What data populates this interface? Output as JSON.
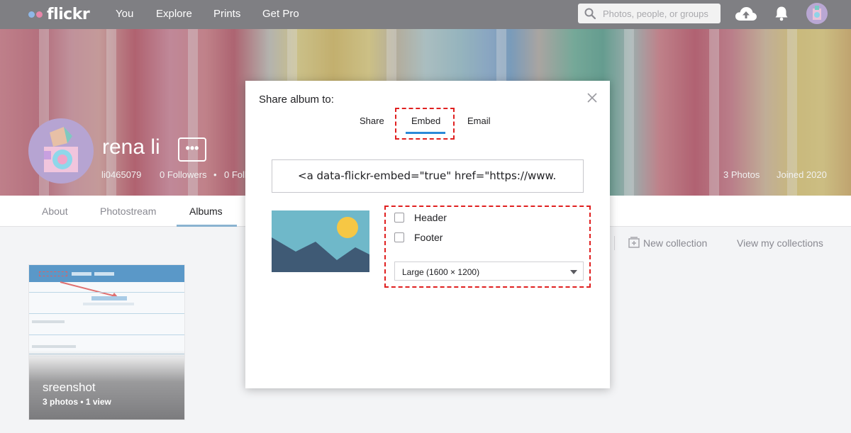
{
  "nav": {
    "logo": "flickr",
    "links": [
      "You",
      "Explore",
      "Prints",
      "Get Pro"
    ],
    "search_placeholder": "Photos, people, or groups",
    "icons": [
      "search-icon",
      "upload-cloud-icon",
      "bell-icon",
      "avatar"
    ]
  },
  "profile": {
    "name": "rena li",
    "more": "•••",
    "username": "li0465079",
    "followers": "0 Followers",
    "following_partial": "0 Foll",
    "photos": "3 Photos",
    "joined": "Joined 2020"
  },
  "subnav": {
    "tabs": [
      "About",
      "Photostream",
      "Albums"
    ],
    "active": "Albums"
  },
  "collections": {
    "new_label": "New collection",
    "view_label": "View my collections"
  },
  "album": {
    "title": "sreenshot",
    "meta": "3 photos  •  1 view"
  },
  "modal": {
    "title": "Share album to:",
    "tabs": [
      "Share",
      "Embed",
      "Email"
    ],
    "active_tab": "Embed",
    "embed_code": "<a data-flickr-embed=\"true\" href=\"https://www.",
    "options": {
      "header_label": "Header",
      "footer_label": "Footer",
      "header_checked": false,
      "footer_checked": false
    },
    "size_select": "Large (1600 × 1200)"
  },
  "colors": {
    "nav_bg": "#7f7f83",
    "accent_blue": "#2b8ad8",
    "highlight_red": "#e02020"
  }
}
